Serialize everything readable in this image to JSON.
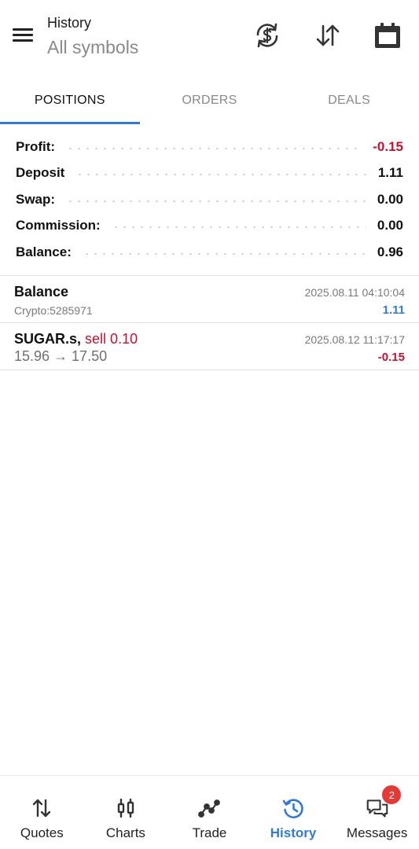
{
  "header": {
    "title": "History",
    "subtitle": "All symbols"
  },
  "tabs": [
    {
      "label": "POSITIONS",
      "active": true
    },
    {
      "label": "ORDERS",
      "active": false
    },
    {
      "label": "DEALS",
      "active": false
    }
  ],
  "summary": [
    {
      "label": "Profit:",
      "value": "-0.15",
      "negative": true
    },
    {
      "label": "Deposit",
      "value": "1.11",
      "negative": false
    },
    {
      "label": "Swap:",
      "value": "0.00",
      "negative": false
    },
    {
      "label": "Commission:",
      "value": "0.00",
      "negative": false
    },
    {
      "label": "Balance:",
      "value": "0.96",
      "negative": false
    }
  ],
  "deals": [
    {
      "title": "Balance",
      "subtitle": "Crypto:5285971",
      "time": "2025.08.11 04:10:04",
      "amount": "1.11"
    },
    {
      "symbol": "SUGAR.s,",
      "side": "sell 0.10",
      "prices": "15.96 → 17.50",
      "time": "2025.08.12 11:17:17",
      "amount": "-0.15"
    }
  ],
  "nav": {
    "quotes": "Quotes",
    "charts": "Charts",
    "trade": "Trade",
    "history": "History",
    "messages": "Messages",
    "messages_badge": "2"
  },
  "colors": {
    "accent": "#2f7bd9",
    "negative": "#c8102e",
    "badge": "#e53935"
  },
  "icons": [
    "menu-icon",
    "currency-exchange-icon",
    "sort-icon",
    "calendar-icon",
    "quotes-icon",
    "charts-icon",
    "trade-icon",
    "history-icon",
    "messages-icon"
  ]
}
